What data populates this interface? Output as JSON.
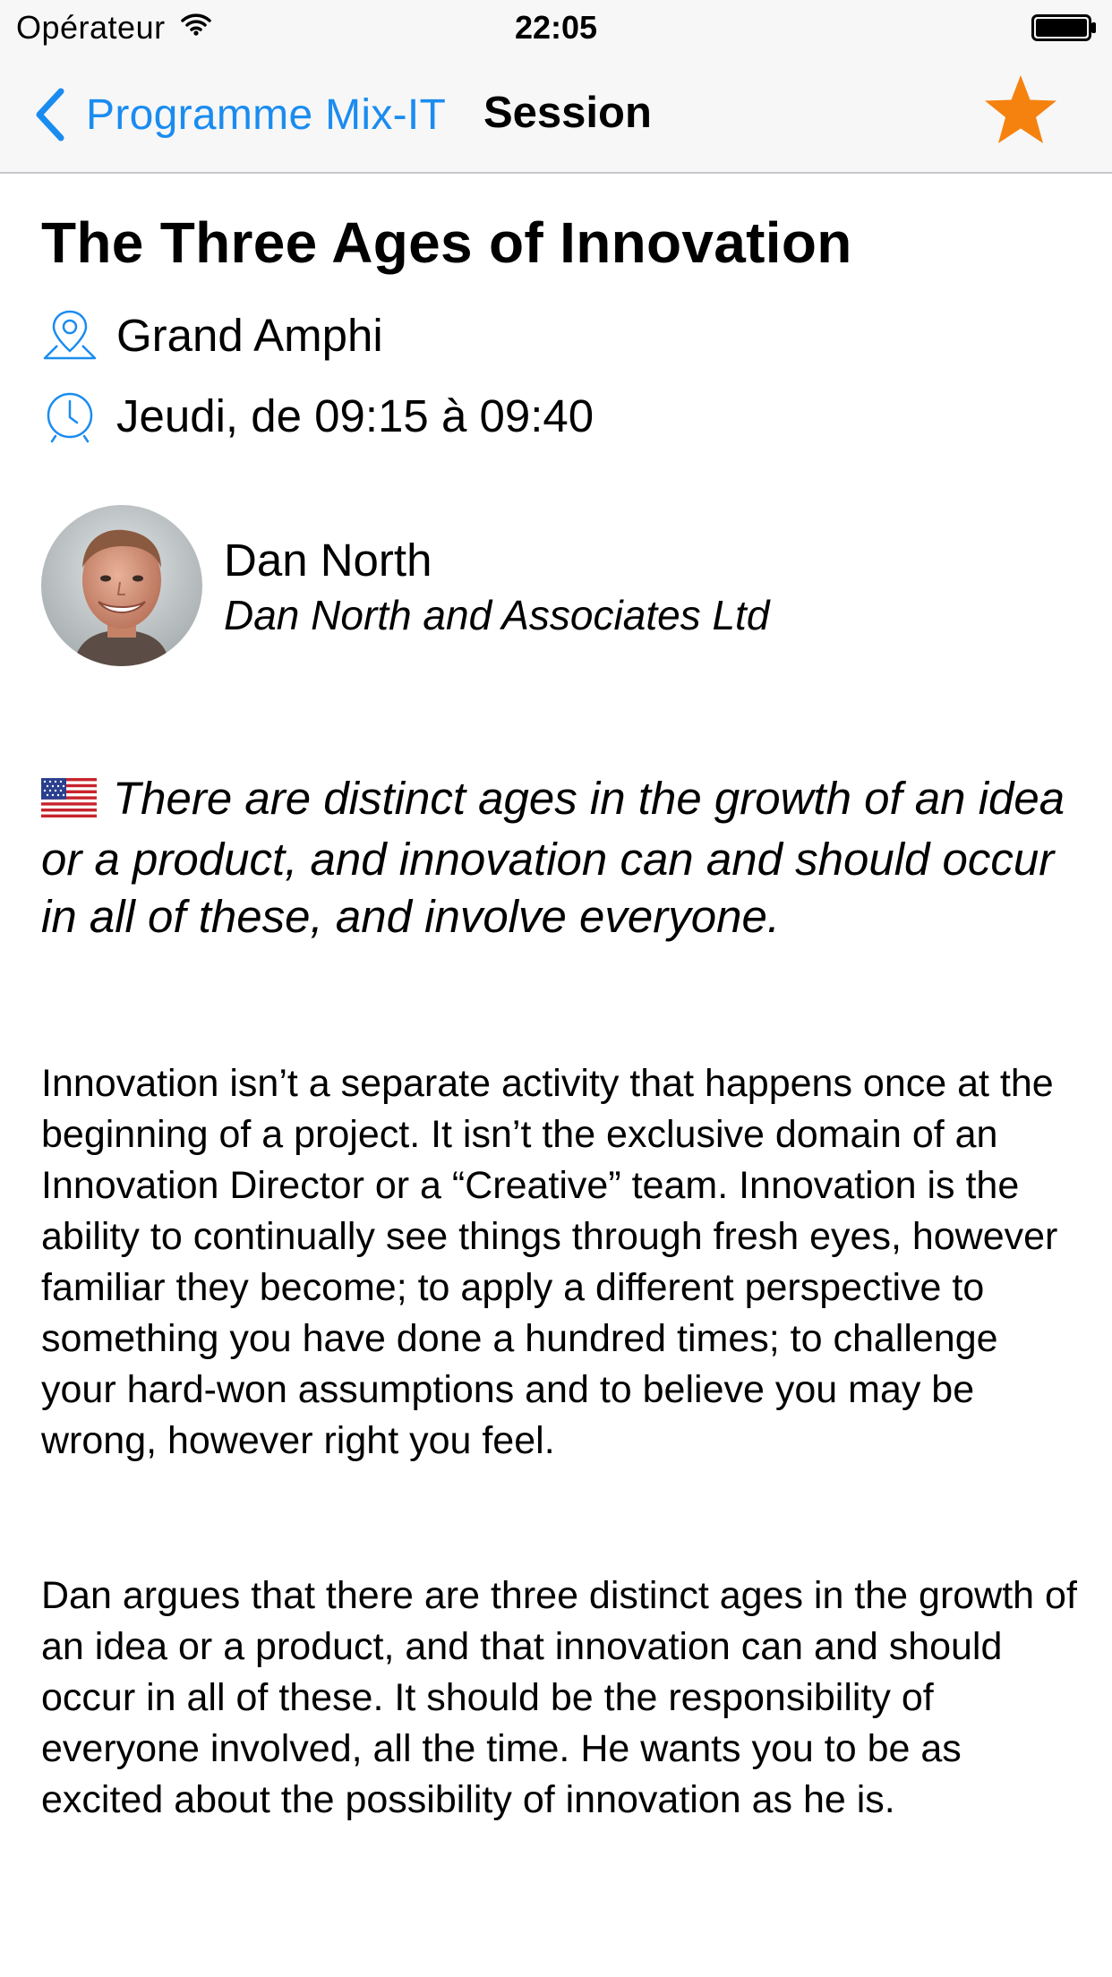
{
  "status_bar": {
    "carrier": "Opérateur",
    "time": "22:05"
  },
  "nav": {
    "back_label": "Programme Mix-IT",
    "title": "Session",
    "favorite_icon": "star-icon",
    "accent_color": "#1a8cf0",
    "favorite_color": "#f5820f"
  },
  "session": {
    "title": "The Three Ages of Innovation",
    "room": "Grand Amphi",
    "schedule": "Jeudi, de 09:15 à 09:40",
    "language_flag": "us-flag-icon",
    "summary": "There are distinct ages in the growth of an idea or a product, and innovation can and should occur in all of these, and involve everyone.",
    "description_paragraphs": [
      "Innovation isn’t a separate activity that happens once at the beginning of a project. It isn’t the exclusive domain of an Innovation Director or a “Creative” team. Innovation is the ability to continually see things through fresh eyes, however familiar they become; to apply a different perspective to something you have done a hundred times; to challenge your hard-won assumptions and to believe you may be wrong, however right you feel.",
      "Dan argues that there are three distinct ages in the growth of an idea or a product, and that innovation can and should occur in all of these. It should be the responsibility of everyone involved, all the time. He wants you to be as excited about the possibility of innovation as he is."
    ]
  },
  "speaker": {
    "name": "Dan North",
    "company": "Dan North and Associates Ltd"
  }
}
